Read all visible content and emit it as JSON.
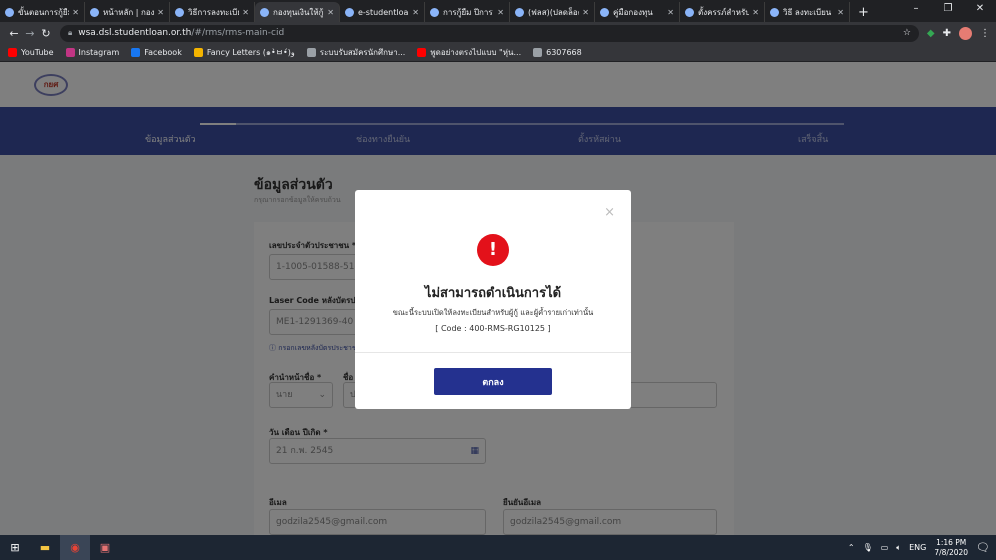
{
  "browser": {
    "tabs": [
      {
        "title": "ขั้นตอนการกู้ยืม",
        "active": false
      },
      {
        "title": "หน้าหลัก | กองทุน",
        "active": false
      },
      {
        "title": "วิธีการลงทะเบียน",
        "active": false
      },
      {
        "title": "กองทุนเงินให้กู้ยืม",
        "active": true
      },
      {
        "title": "e-studentloan",
        "active": false
      },
      {
        "title": "การกู้ยืม ปีการ",
        "active": false
      },
      {
        "title": "(ฟลส)(ปลดล็อค",
        "active": false
      },
      {
        "title": "คู่มือกองทุน",
        "active": false
      },
      {
        "title": "ตั้งครรภ์สำหรับ",
        "active": false
      },
      {
        "title": "วิธี ลงทะเบียน",
        "active": false
      }
    ],
    "url_host": "wsa.dsl.studentloan.or.th",
    "url_path": "/#/rms/rms-main-cid",
    "bookmarks": [
      "YouTube",
      "Instagram",
      "Facebook",
      "Fancy Letters (๑•̀ㅂ•́)و",
      "ระบบรับสมัครนักศึกษา...",
      "พูดอย่างตรงไปแบบ \"หุ่น...",
      "6307668"
    ],
    "bookmark_colors": [
      "#ff0000",
      "#c13584",
      "#1877f2",
      "#f4b400",
      "#9aa0a6",
      "#ff0000",
      "#9aa0a6"
    ]
  },
  "site": {
    "logo_text": "กยศ",
    "steps": [
      "ข้อมูลส่วนตัว",
      "ช่องทางยืนยัน",
      "ตั้งรหัสผ่าน",
      "เสร็จสิ้น"
    ],
    "section_title": "ข้อมูลส่วนตัว",
    "section_sub": "กรุณากรอกข้อมูลให้ครบถ้วน",
    "fields": {
      "cid_label": "เลขประจำตัวประชาชน *",
      "cid_value": "1-1005-01588-51-",
      "laser_label": "Laser Code หลังบัตรประชาชน *",
      "laser_value": "ME1-1291369-40",
      "laser_hint": "กรอกเลขหลังบัตรประชาชน (ไม่ต้องกรอกขีด)",
      "prefix_label": "คำนำหน้าชื่อ *",
      "prefix_value": "นาย",
      "name_label": "ชื่อ",
      "name_value": "ป",
      "dob_label": "วัน เดือน ปีเกิด *",
      "dob_value": "21 ก.พ. 2545",
      "email_label": "อีเมล",
      "email_value": "godzila2545@gmail.com",
      "email_confirm_label": "ยืนยันอีเมล",
      "email_confirm_value": "godzila2545@gmail.com"
    }
  },
  "modal": {
    "icon": "!",
    "title": "ไม่สามารถดำเนินการได้",
    "message": "ขณะนี้ระบบเปิดให้ลงทะเบียนสำหรับผู้กู้ และผู้ค้ำรายเก่าเท่านั้น",
    "code": "[ Code : 400-RMS-RG10125 ]",
    "ok_label": "ตกลง",
    "close_icon": "×"
  },
  "taskbar": {
    "lang": "ENG",
    "time": "1:16 PM",
    "date": "7/8/2020"
  }
}
